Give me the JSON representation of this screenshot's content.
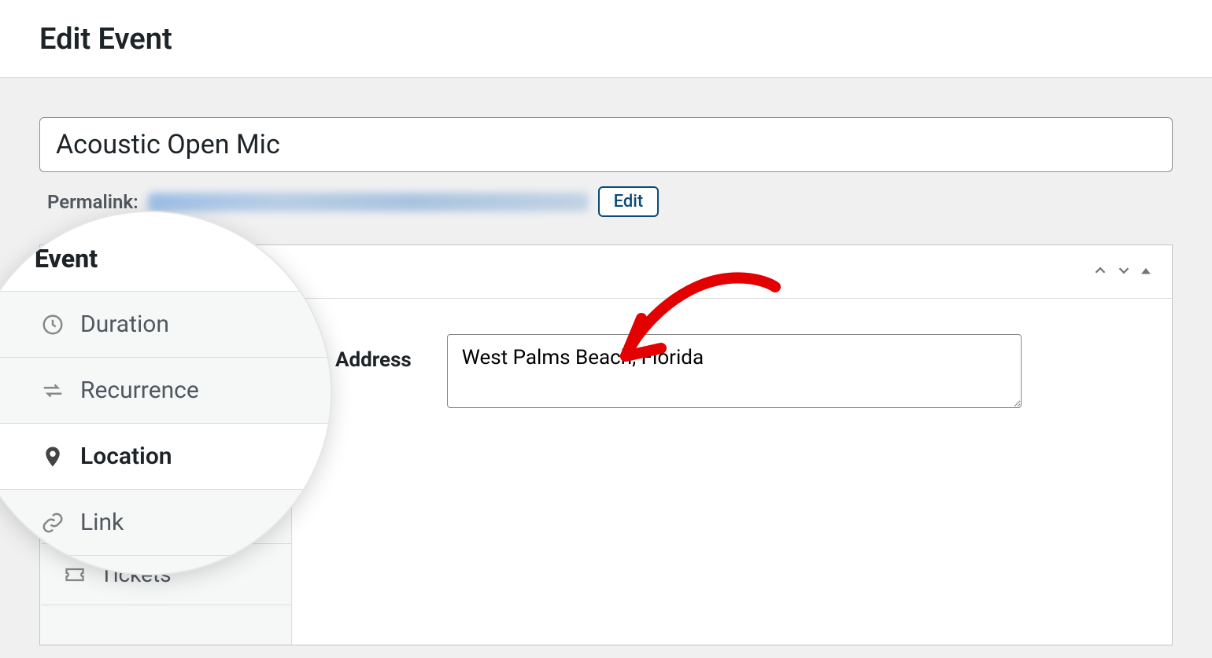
{
  "header": {
    "title": "Edit Event"
  },
  "title_input": {
    "value": "Acoustic Open Mic"
  },
  "permalink": {
    "label": "Permalink:",
    "edit_button": "Edit"
  },
  "panel": {
    "title": "Event",
    "tabs": [
      {
        "label": "Duration"
      },
      {
        "label": "Recurrence"
      },
      {
        "label": "Location"
      },
      {
        "label": "Link"
      },
      {
        "label": "Tickets"
      }
    ],
    "address": {
      "label": "Address",
      "value": "West Palms Beach, Florida"
    }
  }
}
